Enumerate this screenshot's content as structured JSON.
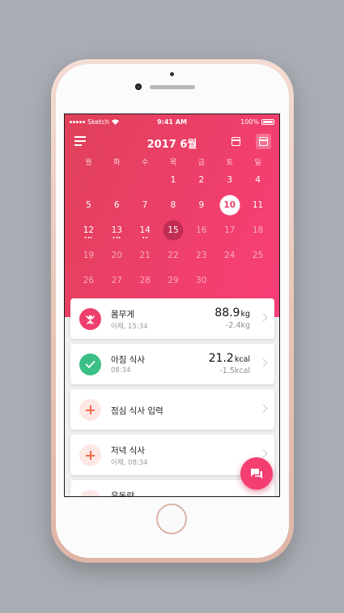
{
  "status_bar": {
    "carrier": "Sketch",
    "time": "9:41 AM",
    "battery": "100%"
  },
  "header": {
    "title": "2017 6월"
  },
  "calendar": {
    "weekdays": [
      "월",
      "화",
      "수",
      "목",
      "금",
      "토",
      "일"
    ],
    "days": [
      {
        "label": "",
        "state": "empty"
      },
      {
        "label": "",
        "state": "empty"
      },
      {
        "label": "",
        "state": "empty"
      },
      {
        "label": "1",
        "state": "past"
      },
      {
        "label": "2",
        "state": "past"
      },
      {
        "label": "3",
        "state": "past"
      },
      {
        "label": "4",
        "state": "past"
      },
      {
        "label": "5",
        "state": "past"
      },
      {
        "label": "6",
        "state": "past"
      },
      {
        "label": "7",
        "state": "past"
      },
      {
        "label": "8",
        "state": "past"
      },
      {
        "label": "9",
        "state": "past"
      },
      {
        "label": "10",
        "state": "today"
      },
      {
        "label": "11",
        "state": "past"
      },
      {
        "label": "12",
        "state": "past",
        "markers": 3
      },
      {
        "label": "13",
        "state": "past",
        "markers": 3
      },
      {
        "label": "14",
        "state": "past",
        "markers": 2
      },
      {
        "label": "15",
        "state": "selected"
      },
      {
        "label": "16",
        "state": "future"
      },
      {
        "label": "17",
        "state": "future"
      },
      {
        "label": "18",
        "state": "future"
      },
      {
        "label": "19",
        "state": "future"
      },
      {
        "label": "20",
        "state": "future"
      },
      {
        "label": "21",
        "state": "future"
      },
      {
        "label": "22",
        "state": "future"
      },
      {
        "label": "23",
        "state": "future"
      },
      {
        "label": "24",
        "state": "future"
      },
      {
        "label": "25",
        "state": "future"
      },
      {
        "label": "26",
        "state": "future"
      },
      {
        "label": "27",
        "state": "future"
      },
      {
        "label": "28",
        "state": "future"
      },
      {
        "label": "29",
        "state": "future"
      },
      {
        "label": "30",
        "state": "future"
      }
    ]
  },
  "cards": {
    "weight": {
      "label": "몸무게",
      "sub": "어제, 15:34",
      "value": "88.9",
      "unit": "kg",
      "delta": "-2.4kg"
    },
    "breakfast": {
      "label": "아침 식사",
      "sub": "08:34",
      "value": "21.2",
      "unit": "kcal",
      "delta": "-1.5kcal"
    },
    "lunch": {
      "label": "점심 식사 입력"
    },
    "dinner": {
      "label": "저녁 식사",
      "sub": "어제, 08:34"
    },
    "exercise": {
      "label": "운동량"
    }
  },
  "colors": {
    "accent": "#EE3F6C",
    "success": "#3CBF86",
    "add": "#F06A4C"
  },
  "icons": [
    "menu-icon",
    "single-day-view-icon",
    "month-view-icon",
    "scale-icon",
    "check-icon",
    "plus-icon",
    "chevron-right-icon",
    "chat-icon",
    "wifi-icon",
    "battery-icon"
  ]
}
